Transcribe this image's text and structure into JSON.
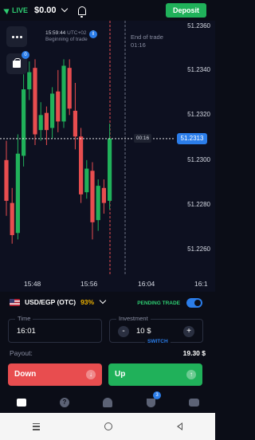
{
  "header": {
    "live_label": "LIVE",
    "balance": "$0.00",
    "deposit_label": "Deposit"
  },
  "chart": {
    "begin_time": "15:59:44",
    "begin_suffix": "UTC+02",
    "begin_label": "Beginning of trade",
    "end_label": "End of trade",
    "end_time": "01:16",
    "countdown": "00:16",
    "current_price": "51.2313",
    "info_badge": "i",
    "side_badge": "0",
    "up_color": "#20b15a",
    "down_color": "#e84d4f",
    "price_color": "#2b7de9"
  },
  "chart_data": {
    "type": "candlestick",
    "price_ticks": [
      "51.2360",
      "51.2340",
      "51.2320",
      "51.2300",
      "51.2280",
      "51.2260"
    ],
    "time_ticks": [
      "15:48",
      "15:56",
      "16:04",
      "16:1"
    ],
    "ylim": [
      51.2252,
      51.2368
    ],
    "current_price": 51.2313,
    "candles": [
      {
        "o": 51.2303,
        "c": 51.2284,
        "h": 51.2312,
        "l": 51.2277
      },
      {
        "o": 51.2283,
        "c": 51.2268,
        "h": 51.229,
        "l": 51.2264
      },
      {
        "o": 51.2269,
        "c": 51.2306,
        "h": 51.2315,
        "l": 51.2266
      },
      {
        "o": 51.2305,
        "c": 51.2336,
        "h": 51.2343,
        "l": 51.23
      },
      {
        "o": 51.2336,
        "c": 51.2344,
        "h": 51.2349,
        "l": 51.2331
      },
      {
        "o": 51.2346,
        "c": 51.2315,
        "h": 51.235,
        "l": 51.231
      },
      {
        "o": 51.2317,
        "c": 51.2324,
        "h": 51.233,
        "l": 51.2312
      },
      {
        "o": 51.2325,
        "c": 51.2317,
        "h": 51.2328,
        "l": 51.231
      },
      {
        "o": 51.2318,
        "c": 51.2334,
        "h": 51.2337,
        "l": 51.2313
      },
      {
        "o": 51.2335,
        "c": 51.2321,
        "h": 51.2345,
        "l": 51.2316
      },
      {
        "o": 51.2321,
        "c": 51.2347,
        "h": 51.235,
        "l": 51.2318
      },
      {
        "o": 51.2346,
        "c": 51.2327,
        "h": 51.235,
        "l": 51.2324
      },
      {
        "o": 51.2326,
        "c": 51.2314,
        "h": 51.2339,
        "l": 51.2308
      },
      {
        "o": 51.2314,
        "c": 51.2287,
        "h": 51.2318,
        "l": 51.2283
      },
      {
        "o": 51.2288,
        "c": 51.2299,
        "h": 51.2303,
        "l": 51.2285
      },
      {
        "o": 51.2298,
        "c": 51.2274,
        "h": 51.2302,
        "l": 51.2266
      },
      {
        "o": 51.2275,
        "c": 51.2291,
        "h": 51.2294,
        "l": 51.227
      },
      {
        "o": 51.229,
        "c": 51.2283,
        "h": 51.2294,
        "l": 51.2278
      },
      {
        "o": 51.2284,
        "c": 51.2313,
        "h": 51.232,
        "l": 51.228
      }
    ]
  },
  "asset": {
    "pair": "USD/EGP (OTC)",
    "payout_pct": "93%",
    "pending_label": "PENDING TRADE"
  },
  "trade": {
    "time_label": "Time",
    "time_value": "16:01",
    "investment_label": "Investment",
    "investment_value": "10 $",
    "minus": "-",
    "plus": "+",
    "switch_label": "SWITCH",
    "payout_label": "Payout:",
    "payout_value": "19.30 $",
    "down_label": "Down",
    "up_label": "Up",
    "down_arrow": "↓",
    "up_arrow": "↑"
  },
  "tabs": {
    "help_glyph": "?",
    "trophy_badge": "3"
  }
}
